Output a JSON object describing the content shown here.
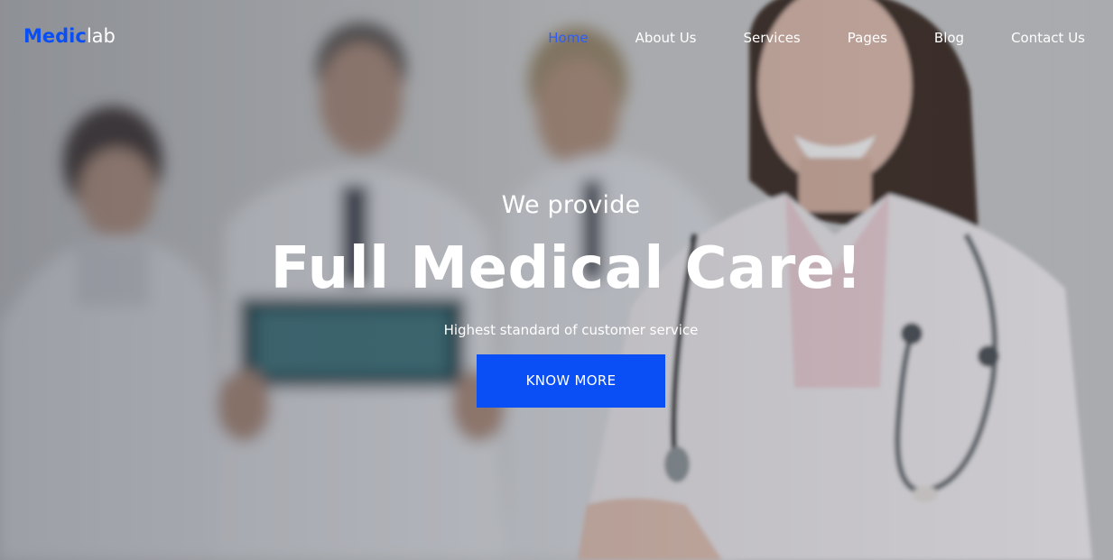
{
  "brand": {
    "name_strong": "Medic",
    "name_light": "lab",
    "accent_color": "#0a4ff5"
  },
  "nav": {
    "items": [
      {
        "label": "Home",
        "active": true
      },
      {
        "label": "About Us",
        "active": false
      },
      {
        "label": "Services",
        "active": false
      },
      {
        "label": "Pages",
        "active": false
      },
      {
        "label": "Blog",
        "active": false
      },
      {
        "label": "Contact Us",
        "active": false
      }
    ],
    "active_color": "#2d5ef7"
  },
  "hero": {
    "kicker": "We provide",
    "headline": "Full Medical Care!",
    "tagline": "Highest standard of customer service",
    "cta_label": "KNOW MORE"
  }
}
